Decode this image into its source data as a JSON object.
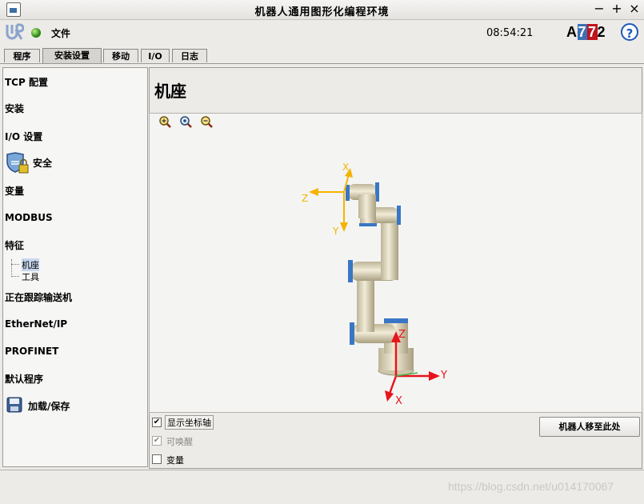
{
  "window": {
    "title": "机器人通用图形化编程环境",
    "controls": [
      "−",
      "+",
      "×"
    ]
  },
  "header": {
    "file_menu": "文件",
    "time": "08:54:21",
    "robot_id": {
      "a": "A",
      "b": "7",
      "c": "7",
      "d": "2"
    },
    "help": "?"
  },
  "tabs": [
    {
      "label": "程序"
    },
    {
      "label": "安装设置",
      "active": true
    },
    {
      "label": "移动"
    },
    {
      "label": "I/O"
    },
    {
      "label": "日志"
    }
  ],
  "sidebar": {
    "items": [
      {
        "label": "TCP 配置"
      },
      {
        "label": "安装"
      },
      {
        "label": "I/O 设置"
      },
      {
        "label": "安全"
      },
      {
        "label": "变量"
      },
      {
        "label": "MODBUS"
      },
      {
        "label": "特征"
      },
      {
        "label": "正在跟踪输送机"
      },
      {
        "label": "EtherNet/IP"
      },
      {
        "label": "PROFINET"
      },
      {
        "label": "默认程序"
      },
      {
        "label": "加载/保存"
      }
    ],
    "feature_children": [
      {
        "label": "机座",
        "selected": true
      },
      {
        "label": "工具"
      }
    ]
  },
  "main": {
    "title": "机座",
    "axes": {
      "base": {
        "x": "X",
        "y": "Y",
        "z": "Z",
        "color": "#e8141c"
      },
      "tool": {
        "x": "X",
        "y": "Y",
        "z": "Z",
        "color": "#f5b400"
      }
    },
    "checkboxes": [
      {
        "label": "显示坐标轴",
        "checked": true,
        "enabled": true
      },
      {
        "label": "可唤醒",
        "checked": true,
        "enabled": false
      },
      {
        "label": "变量",
        "checked": false,
        "enabled": true
      }
    ],
    "move_button": "机器人移至此处"
  },
  "watermark": "https://blog.csdn.net/u014170067"
}
